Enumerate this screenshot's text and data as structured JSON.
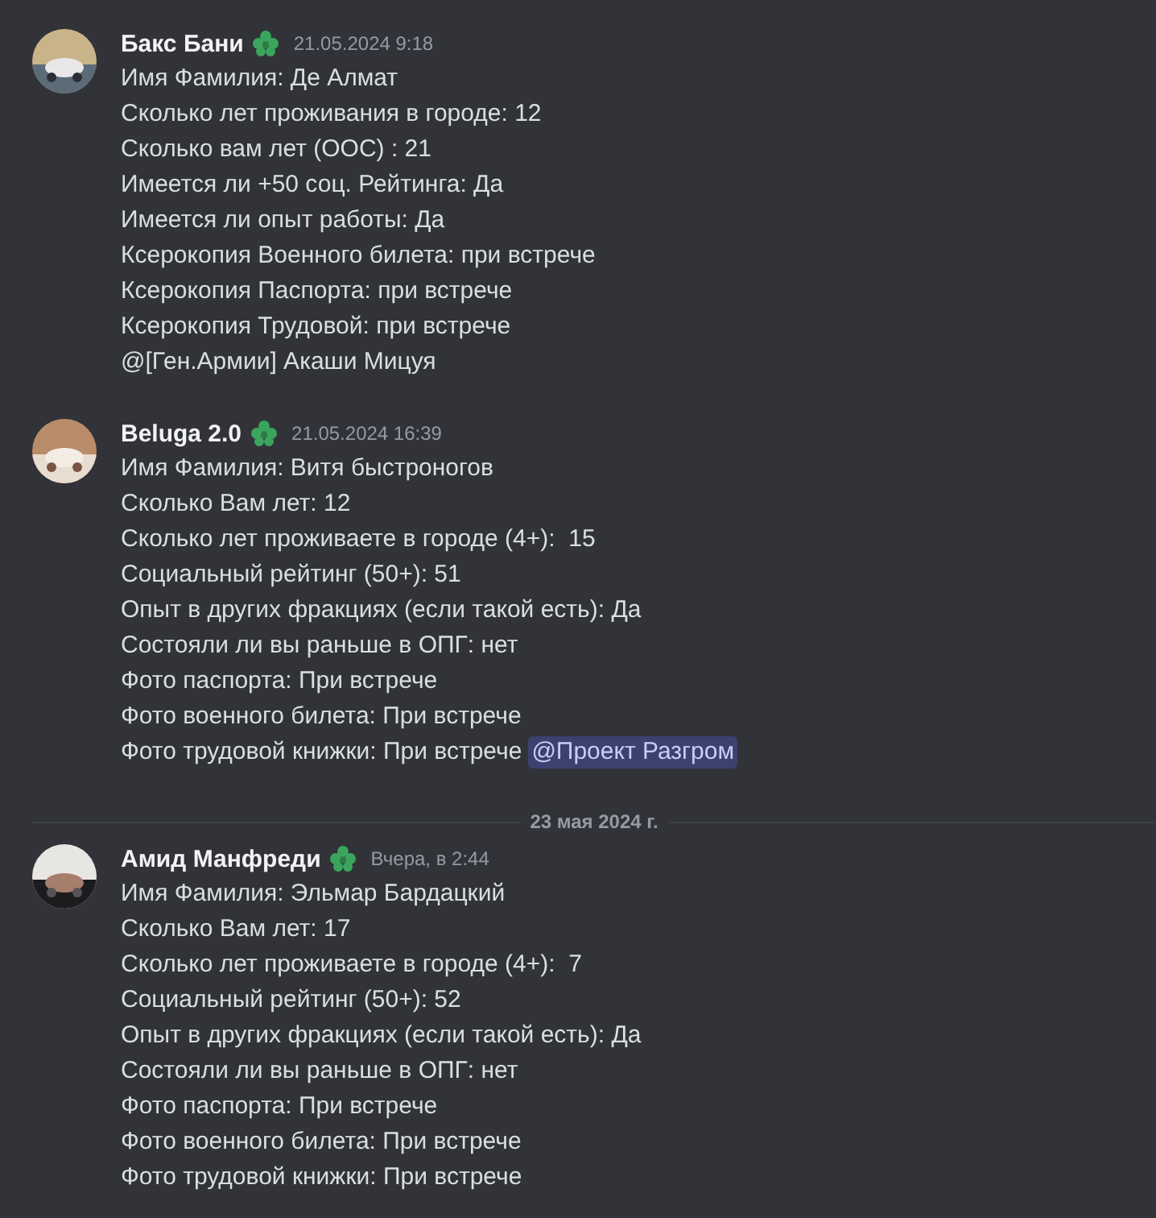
{
  "messages": [
    {
      "author": "Бакс Бани",
      "timestamp": "21.05.2024 9:18",
      "lines": [
        {
          "text": "Имя Фамилия: Де Алмат"
        },
        {
          "text": "Сколько лет проживания в городе: 12"
        },
        {
          "text": "Сколько вам лет (ООС) : 21"
        },
        {
          "text": "Имеется ли +50 соц. Рейтинга: Да"
        },
        {
          "text": "Имеется ли опыт работы: Да"
        },
        {
          "text": "Ксерокопия Военного билета: при встрече"
        },
        {
          "text": "Ксерокопия Паспорта: при встрече"
        },
        {
          "text": "Ксерокопия Трудовой: при встрече"
        },
        {
          "text": "@[Ген.Армии] Акаши Мицуя"
        }
      ]
    },
    {
      "author": "Beluga 2.0",
      "timestamp": "21.05.2024 16:39",
      "lines": [
        {
          "text": "Имя Фамилия: Витя быстроногов"
        },
        {
          "text": "Сколько Вам лет: 12"
        },
        {
          "text": "Сколько лет проживаете в городе (4+):  15"
        },
        {
          "text": "Социальный рейтинг (50+): 51"
        },
        {
          "text": "Опыт в других фракциях (если такой есть): Да"
        },
        {
          "text": "Состояли ли вы раньше в ОПГ: нет"
        },
        {
          "text": "Фото паспорта: При встрече"
        },
        {
          "text": "Фото военного билета: При встрече"
        },
        {
          "text": "Фото трудовой книжки: При встрече",
          "mention": "@Проект Разгром"
        }
      ]
    },
    {
      "date_divider": "23 мая 2024 г.",
      "author": "Амид Манфреди",
      "timestamp": "Вчера, в 2:44",
      "lines": [
        {
          "text": "Имя Фамилия: Эльмар Бардацкий"
        },
        {
          "text": "Сколько Вам лет: 17"
        },
        {
          "text": "Сколько лет проживаете в городе (4+):  7"
        },
        {
          "text": "Социальный рейтинг (50+): 52"
        },
        {
          "text": "Опыт в других фракциях (если такой есть): Да"
        },
        {
          "text": "Состояли ли вы раньше в ОПГ: нет"
        },
        {
          "text": "Фото паспорта: При встрече"
        },
        {
          "text": "Фото военного билета: При встрече"
        },
        {
          "text": "Фото трудовой книжки: При встрече"
        }
      ]
    }
  ]
}
